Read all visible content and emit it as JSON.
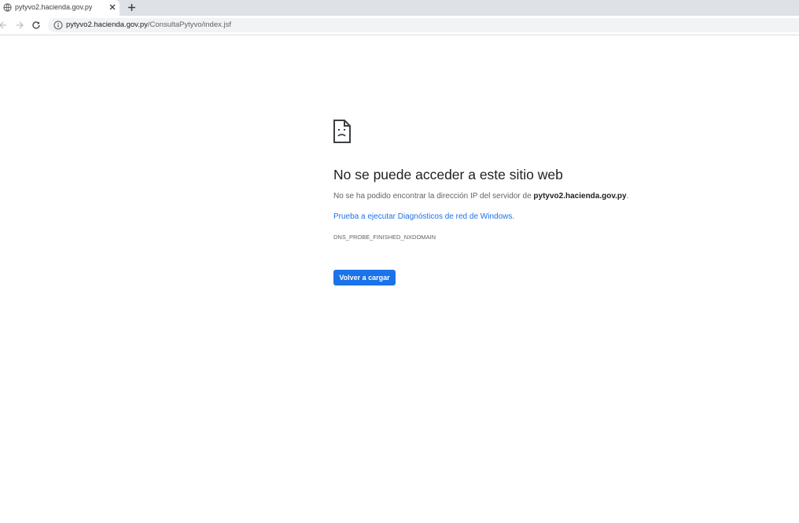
{
  "browser": {
    "tab": {
      "title": "pytyvo2.hacienda.gov.py",
      "favicon": "globe-icon"
    },
    "toolbar": {
      "back": "back-arrow-icon",
      "forward": "forward-arrow-icon",
      "reload": "reload-icon",
      "site_info": "info-icon",
      "url_host": "pytyvo2.hacienda.gov.py",
      "url_path": "/ConsultaPytyvo/index.jsf"
    }
  },
  "error_page": {
    "icon": "sad-page-icon",
    "heading": "No se puede acceder a este sitio web",
    "description_prefix": "No se ha podido encontrar la dirección IP del servidor de ",
    "description_host": "pytyvo2.hacienda.gov.py",
    "description_suffix": ".",
    "diagnostics_link": "Prueba a ejecutar Diagnósticos de red de Windows.",
    "error_code": "DNS_PROBE_FINISHED_NXDOMAIN",
    "reload_button": "Volver a cargar"
  },
  "colors": {
    "accent": "#1a73e8",
    "tabstrip": "#dee1e6",
    "omnibox": "#f1f3f4"
  }
}
